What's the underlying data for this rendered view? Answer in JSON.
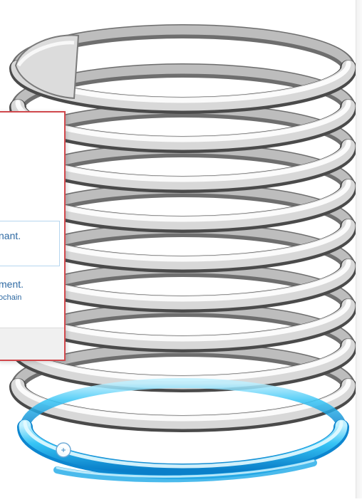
{
  "dialog": {
    "info_text": "nant.",
    "message_text": "ment.",
    "sub_text": "ochain"
  },
  "viewport": {
    "spring_color": "#e0e0e0",
    "selection_color": "#1fa8e8",
    "handle_symbol": "+"
  }
}
